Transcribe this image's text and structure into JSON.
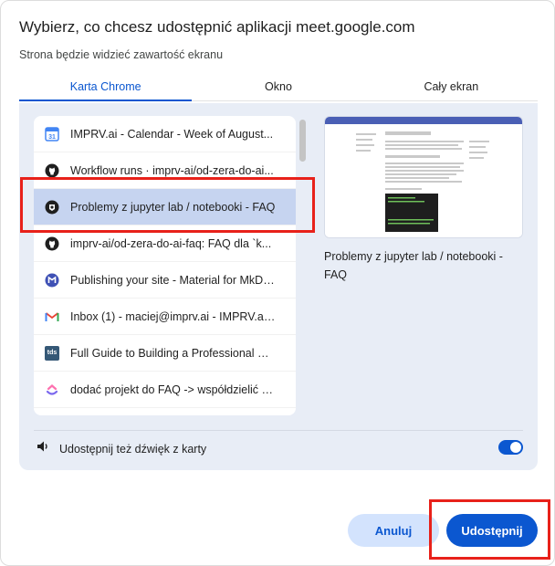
{
  "dialog": {
    "title": "Wybierz, co chcesz udostępnić aplikacji meet.google.com",
    "subtitle": "Strona będzie widzieć zawartość ekranu"
  },
  "tabs": [
    {
      "label": "Karta Chrome",
      "active": true
    },
    {
      "label": "Okno",
      "active": false
    },
    {
      "label": "Cały ekran",
      "active": false
    }
  ],
  "tab_list": [
    {
      "label": "IMPRV.ai - Calendar - Week of August...",
      "icon": "google-calendar-icon"
    },
    {
      "label": "Workflow runs · imprv-ai/od-zera-do-ai...",
      "icon": "github-icon"
    },
    {
      "label": "Problemy z jupyter lab / notebooki - FAQ",
      "icon": "discourse-icon",
      "selected": true
    },
    {
      "label": "imprv-ai/od-zera-do-ai-faq: FAQ dla `k...",
      "icon": "github-icon"
    },
    {
      "label": "Publishing your site - Material for MkDo...",
      "icon": "mkdocs-material-icon"
    },
    {
      "label": "Inbox (1) - maciej@imprv.ai - IMPRV.ai...",
      "icon": "gmail-icon"
    },
    {
      "label": "Full Guide to Building a Professional Por...",
      "icon": "tds-icon",
      "icon_text": "tds"
    },
    {
      "label": "dodać projekt do FAQ -> współdzielić z...",
      "icon": "clickup-icon"
    }
  ],
  "preview": {
    "caption": "Problemy z jupyter lab / notebooki - FAQ"
  },
  "audio": {
    "label": "Udostępnij też dźwięk z karty",
    "enabled": true
  },
  "buttons": {
    "cancel": "Anuluj",
    "share": "Udostępnij"
  },
  "colors": {
    "accent": "#0b57d0",
    "selected_row": "#c6d4f0",
    "panel_bg": "#e8edf6",
    "annotation_red": "#e8211a"
  }
}
